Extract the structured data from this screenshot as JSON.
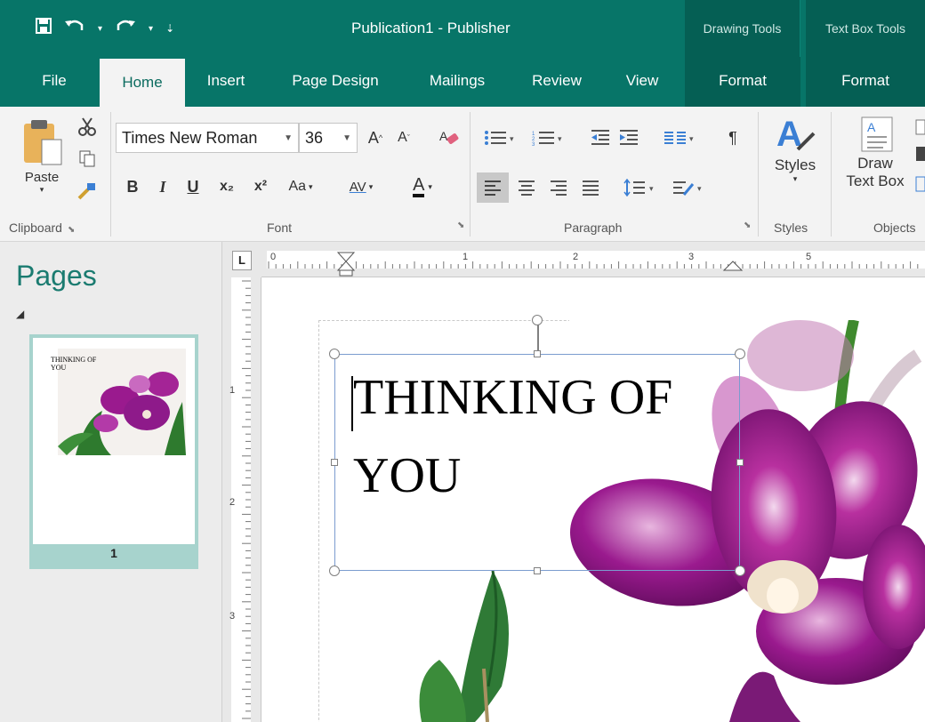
{
  "window": {
    "title": "Publication1  -  Publisher",
    "context_groups": [
      "Drawing Tools",
      "Text Box Tools"
    ]
  },
  "qat": {
    "save_icon": "save-icon",
    "undo_icon": "undo-icon",
    "redo_icon": "redo-icon",
    "customize_icon": "customize-qat-icon"
  },
  "tabs": [
    {
      "label": "File"
    },
    {
      "label": "Home",
      "active": true
    },
    {
      "label": "Insert"
    },
    {
      "label": "Page Design"
    },
    {
      "label": "Mailings"
    },
    {
      "label": "Review"
    },
    {
      "label": "View"
    },
    {
      "label": "Format"
    },
    {
      "label": "Format"
    }
  ],
  "ribbon": {
    "clipboard": {
      "label": "Clipboard",
      "paste_label": "Paste"
    },
    "font": {
      "label": "Font",
      "font_name": "Times New Roman",
      "font_size": "36",
      "bold": "B",
      "italic": "I",
      "underline": "U",
      "subscript": "x₂",
      "superscript": "x²",
      "change_case": "Aa",
      "char_spacing": "AV",
      "font_color": "A",
      "grow_font": "A",
      "shrink_font": "A"
    },
    "paragraph": {
      "label": "Paragraph",
      "pilcrow": "¶"
    },
    "styles": {
      "label": "Styles",
      "button_label": "Styles"
    },
    "objects": {
      "label": "Objects",
      "draw_textbox_line1": "Draw",
      "draw_textbox_line2": "Text Box"
    }
  },
  "pages_pane": {
    "title": "Pages",
    "pages": [
      {
        "number": "1",
        "thumb_text_line1": "THINKING OF",
        "thumb_text_line2": "YOU"
      }
    ]
  },
  "ruler": {
    "corner_label": "L",
    "h_numbers": [
      "0",
      "1",
      "2",
      "3",
      "5"
    ],
    "v_numbers": [
      "1",
      "2",
      "3"
    ]
  },
  "document": {
    "textbox_line1": "THINKING OF",
    "textbox_line2": "YOU"
  },
  "colors": {
    "title_bar": "#077568",
    "context_tab": "#055f54",
    "accent": "#1a7b70",
    "orchid": "#8e1a8a"
  }
}
